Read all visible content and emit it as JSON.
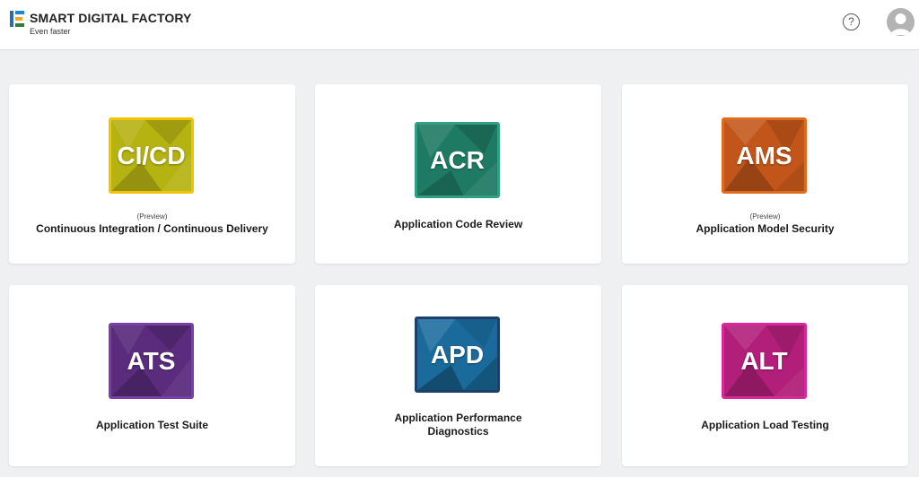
{
  "header": {
    "brand_title": "SMART DIGITAL FACTORY",
    "brand_subtitle": "Even faster",
    "help_icon_glyph": "?",
    "help_icon": "question-circle-icon",
    "avatar_icon": "user-avatar-icon"
  },
  "cards": [
    {
      "abbr": "CI/CD",
      "preview": "(Preview)",
      "title": "Continuous Integration / Continuous Delivery",
      "color": "#b5b312",
      "border": "#f2c400"
    },
    {
      "abbr": "ACR",
      "preview": "",
      "title": "Application Code Review",
      "color": "#1f7a63",
      "border": "#2fa083"
    },
    {
      "abbr": "AMS",
      "preview": "(Preview)",
      "title": "Application Model Security",
      "color": "#c2561a",
      "border": "#e06b1f"
    },
    {
      "abbr": "ATS",
      "preview": "",
      "title": "Application Test Suite",
      "color": "#5b2c7d",
      "border": "#7a3fa5"
    },
    {
      "abbr": "APD",
      "preview": "",
      "title": "Application Performance Diagnostics",
      "color": "#1a6b9c",
      "border": "#1c3f6b"
    },
    {
      "abbr": "ALT",
      "preview": "",
      "title": "Application Load Testing",
      "color": "#b21f7a",
      "border": "#d8289a"
    }
  ]
}
